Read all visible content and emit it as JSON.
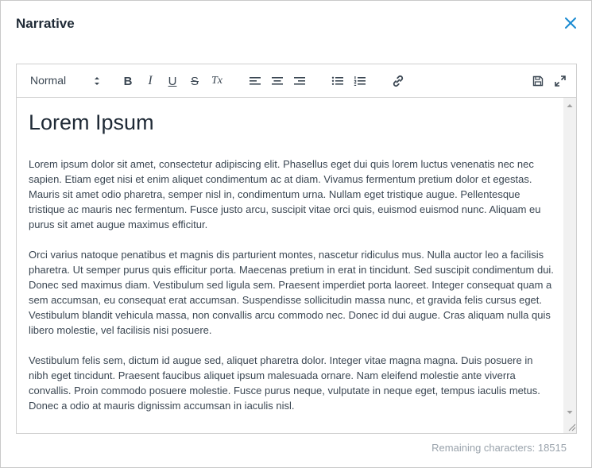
{
  "dialog": {
    "title": "Narrative",
    "close_icon": "close-icon",
    "accent_color": "#1a8bd1"
  },
  "toolbar": {
    "format_select": {
      "selected": "Normal"
    },
    "buttons": [
      {
        "name": "bold",
        "icon": "bold-icon",
        "glyph": "B"
      },
      {
        "name": "italic",
        "icon": "italic-icon",
        "glyph": "I"
      },
      {
        "name": "underline",
        "icon": "underline-icon",
        "glyph": "U"
      },
      {
        "name": "strikethrough",
        "icon": "strikethrough-icon",
        "glyph": "S"
      },
      {
        "name": "clear-format",
        "icon": "clear-format-icon",
        "glyph": "Tx"
      },
      {
        "name": "align-left",
        "icon": "align-left-icon"
      },
      {
        "name": "align-center",
        "icon": "align-center-icon"
      },
      {
        "name": "align-right",
        "icon": "align-right-icon"
      },
      {
        "name": "bullet-list",
        "icon": "bullet-list-icon"
      },
      {
        "name": "numbered-list",
        "icon": "numbered-list-icon"
      },
      {
        "name": "link",
        "icon": "link-icon"
      },
      {
        "name": "save",
        "icon": "save-icon"
      },
      {
        "name": "expand",
        "icon": "expand-icon"
      }
    ]
  },
  "content": {
    "heading": "Lorem Ipsum",
    "paragraphs": [
      "Lorem ipsum dolor sit amet, consectetur adipiscing elit. Phasellus eget dui quis lorem luctus venenatis nec nec sapien. Etiam eget nisi et enim aliquet condimentum ac at diam. Vivamus fermentum pretium dolor et egestas. Mauris sit amet odio pharetra, semper nisl in, condimentum urna. Nullam eget tristique augue. Pellentesque tristique ac mauris nec fermentum. Fusce justo arcu, suscipit vitae orci quis, euismod euismod nunc. Aliquam eu purus sit amet augue maximus efficitur.",
      "Orci varius natoque penatibus et magnis dis parturient montes, nascetur ridiculus mus. Nulla auctor leo a facilisis pharetra. Ut semper purus quis efficitur porta. Maecenas pretium in erat in tincidunt. Sed suscipit condimentum dui. Donec sed maximus diam. Vestibulum sed ligula sem. Praesent imperdiet porta laoreet. Integer consequat quam a sem accumsan, eu consequat erat accumsan. Suspendisse sollicitudin massa nunc, et gravida felis cursus eget. Vestibulum blandit vehicula massa, non convallis arcu commodo nec. Donec id dui augue. Cras aliquam nulla quis libero molestie, vel facilisis nisi posuere.",
      "Vestibulum felis sem, dictum id augue sed, aliquet pharetra dolor. Integer vitae magna magna. Duis posuere in nibh eget tincidunt. Praesent faucibus aliquet ipsum malesuada ornare. Nam eleifend molestie ante viverra convallis. Proin commodo posuere molestie. Fusce purus neque, vulputate in neque eget, tempus iaculis metus. Donec a odio at mauris dignissim accumsan in iaculis nisl."
    ]
  },
  "footer": {
    "remaining_characters": "Remaining characters: 18515"
  }
}
